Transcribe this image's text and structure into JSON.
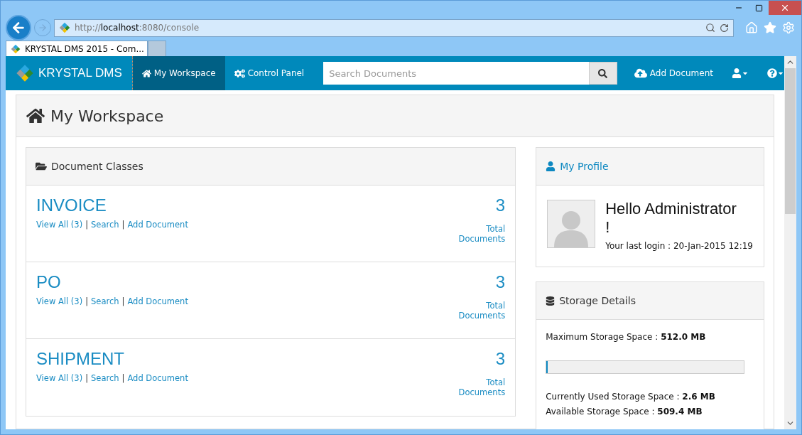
{
  "browser": {
    "url": "http://**localhost**:8080/console",
    "tab": {
      "title": "KRYSTAL DMS 2015 - Com...",
      "selected": true
    }
  },
  "navbar": {
    "brand": "KRYSTAL DMS",
    "items": [
      {
        "kind": "home",
        "label": "My Workspace",
        "selected": true
      },
      {
        "kind": "cogs",
        "label": "Control Panel",
        "selected": false
      }
    ],
    "search": {
      "placeholder": "Search Documents"
    },
    "add_button": "Add Document"
  },
  "page_title": "My Workspace",
  "document_classes": {
    "title": "Document Classes",
    "items": [
      {
        "name": "INVOICE",
        "count": "3",
        "total_label": "Total Documents",
        "links": [
          {
            "kind": "link",
            "text": "View All (3)"
          },
          {
            "kind": "separator",
            "text": "|"
          },
          {
            "kind": "link",
            "text": "Search"
          },
          {
            "kind": "separator",
            "text": "|"
          },
          {
            "kind": "link",
            "text": "Add Document"
          }
        ]
      },
      {
        "name": "PO",
        "count": "3",
        "total_label": "Total Documents",
        "links": [
          {
            "kind": "link",
            "text": "View All (3)"
          },
          {
            "kind": "separator",
            "text": "|"
          },
          {
            "kind": "link",
            "text": "Search"
          },
          {
            "kind": "separator",
            "text": "|"
          },
          {
            "kind": "link",
            "text": "Add Document"
          }
        ]
      },
      {
        "name": "SHIPMENT",
        "count": "3",
        "total_label": "Total Documents",
        "links": [
          {
            "kind": "link",
            "text": "View All (3)"
          },
          {
            "kind": "separator",
            "text": "|"
          },
          {
            "kind": "link",
            "text": "Search"
          },
          {
            "kind": "separator",
            "text": "|"
          },
          {
            "kind": "link",
            "text": "Add Document"
          }
        ]
      }
    ]
  },
  "profile": {
    "title": "My Profile",
    "greeting": "Hello Administrator !",
    "last_login": "Your last login : 20-Jan-2015 12:19"
  },
  "storage": {
    "title": "Storage Details",
    "maximum": "Maximum Storage Space : **512.0 MB**",
    "level": 0.005,
    "used": "Currently Used Storage Space : **2.6 MB**",
    "available": "Available Storage Space : **509.4 MB**"
  }
}
